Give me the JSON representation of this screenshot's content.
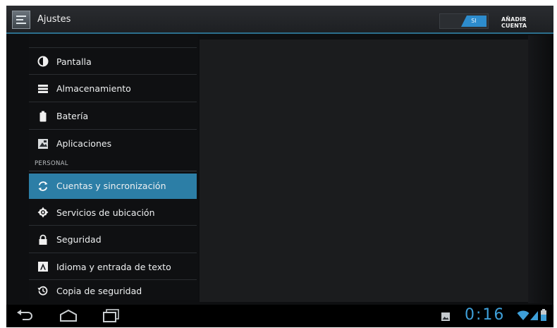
{
  "app": {
    "title": "Ajustes",
    "icon": "settings-icon"
  },
  "toggle": {
    "state_label": "SI"
  },
  "actions": {
    "add_account": "AÑADIR CUENTA"
  },
  "colors": {
    "accent": "#2c7ea6",
    "toggle_on": "#2d8ccd",
    "clock": "#3e9fd8"
  },
  "sidebar": {
    "items_top": [
      {
        "label": "Pantalla",
        "icon": "brightness-icon"
      },
      {
        "label": "Almacenamiento",
        "icon": "storage-icon"
      },
      {
        "label": "Batería",
        "icon": "battery-icon"
      },
      {
        "label": "Aplicaciones",
        "icon": "apps-icon"
      }
    ],
    "section_header": "PERSONAL",
    "items_personal": [
      {
        "label": "Cuentas y sincronización",
        "icon": "sync-icon",
        "selected": true
      },
      {
        "label": "Servicios de ubicación",
        "icon": "location-icon"
      },
      {
        "label": "Seguridad",
        "icon": "lock-icon"
      },
      {
        "label": "Idioma y entrada de texto",
        "icon": "keyboard-icon"
      },
      {
        "label": "Copia de seguridad",
        "icon": "backup-icon"
      }
    ]
  },
  "statusbar": {
    "time": "0:16",
    "icons": [
      "gallery-notification-icon",
      "wifi-icon",
      "signal-icon",
      "battery-status-icon"
    ]
  },
  "navbar": {
    "buttons": [
      "back-icon",
      "home-icon",
      "recent-apps-icon"
    ]
  }
}
